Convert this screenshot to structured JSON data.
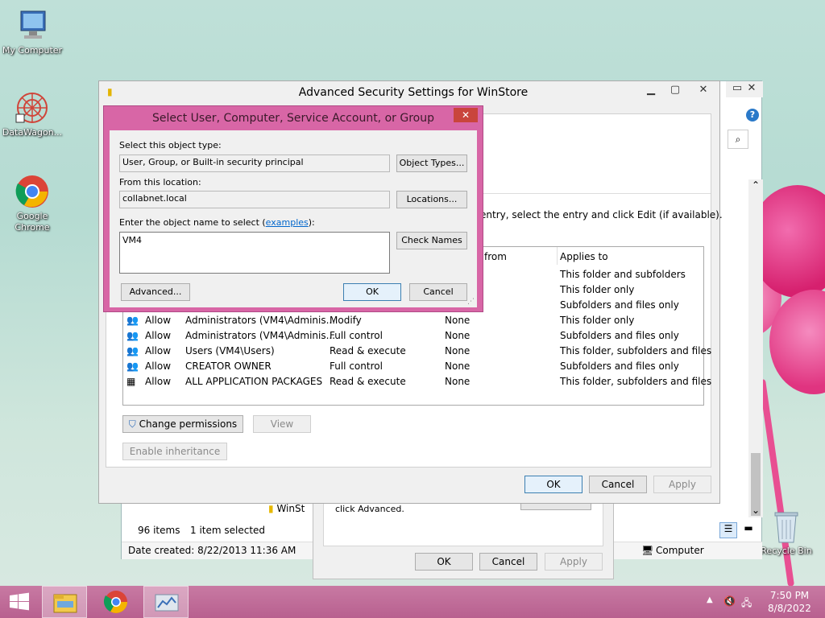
{
  "desktop": {
    "icons": [
      {
        "label": "My Computer"
      },
      {
        "label": "DataWagon..."
      },
      {
        "label": "Google Chrome"
      },
      {
        "label": "Recycle Bin"
      }
    ]
  },
  "advsec": {
    "title": "Advanced Security Settings for WinStore",
    "instruction_fragment": "entry, select the entry and click Edit (if available).",
    "columns": {
      "inherited_from": "from",
      "applies_to": "Applies to"
    },
    "upper_rows": [
      {
        "applies_to": "This folder and subfolders"
      },
      {
        "applies_to": "This folder only"
      },
      {
        "applies_to": "Subfolders and files only"
      }
    ],
    "rows": [
      {
        "type": "Allow",
        "principal": "Administrators (VM4\\Adminis...",
        "access": "Modify",
        "inherited": "None",
        "applies_to": "This folder only"
      },
      {
        "type": "Allow",
        "principal": "Administrators (VM4\\Adminis...",
        "access": "Full control",
        "inherited": "None",
        "applies_to": "Subfolders and files only"
      },
      {
        "type": "Allow",
        "principal": "Users (VM4\\Users)",
        "access": "Read & execute",
        "inherited": "None",
        "applies_to": "This folder, subfolders and files"
      },
      {
        "type": "Allow",
        "principal": "CREATOR OWNER",
        "access": "Full control",
        "inherited": "None",
        "applies_to": "Subfolders and files only"
      },
      {
        "type": "Allow",
        "principal": "ALL APPLICATION PACKAGES",
        "access": "Read & execute",
        "inherited": "None",
        "applies_to": "This folder, subfolders and files"
      }
    ],
    "change_permissions": "Change permissions",
    "view": "View",
    "enable_inheritance": "Enable inheritance",
    "ok": "OK",
    "cancel": "Cancel",
    "apply": "Apply"
  },
  "select_dialog": {
    "title": "Select User, Computer, Service Account, or Group",
    "object_type_label": "Select this object type:",
    "object_type_value": "User, Group, or Built-in security principal",
    "object_types_button": "Object Types...",
    "location_label": "From this location:",
    "location_value": "collabnet.local",
    "locations_button": "Locations...",
    "enter_name_label": "Enter the object name to select (",
    "examples_link": "examples",
    "enter_name_label_end": "):",
    "name_value": "VM4",
    "check_names_button": "Check Names",
    "advanced_button": "Advanced...",
    "ok": "OK",
    "cancel": "Cancel"
  },
  "explorer": {
    "folder_crumb": "WinSt",
    "item_count": "96 items",
    "selected": "1 item selected",
    "date_created": "Date created: 8/22/2013 11:36 AM",
    "computer": "Computer"
  },
  "properties": {
    "text": "click Advanced.",
    "ok": "OK",
    "cancel": "Cancel",
    "apply": "Apply"
  },
  "taskbar": {
    "time": "7:50 PM",
    "date": "8/8/2022"
  },
  "colors": {
    "select_dialog_frame": "#d866a6",
    "taskbar": "#c06a98",
    "link": "#0066cc"
  }
}
